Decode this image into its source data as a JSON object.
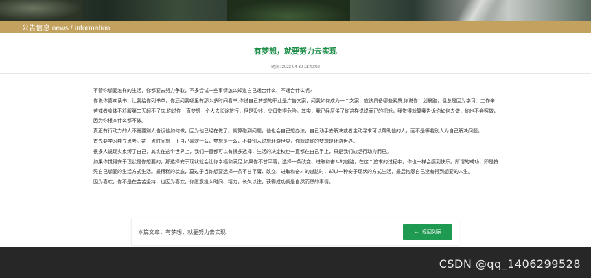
{
  "section": {
    "label": "公告信息 news / information"
  },
  "article": {
    "title": "有梦想，就要努力去实现",
    "time_label": "时间:",
    "time_value": "2023-04-30 11:40:02",
    "paragraphs": [
      "不管你想要怎样的生活，你都要去努力争取，不多尝试一些事情怎么知道自己适合什么、不适合什么呢?",
      "你说你喜欢读书，让我给你列书单，你还问我哪里有那么多时间看书,你说自己梦想的职业是广告文案，问我如何成为一个文案，应该具备哪些素质,你说你计划晨跑，但总是因为学习、工作辛苦或者身体不舒服第二天起不了床,你说你一直梦想一个人去长途旅行，但是没钱，父母觉得危险。其实，我已经厌倦了你这样说说而已的把戏，我觉得就算我告诉你如何去做，你也不会照做，因为你根本什么都不做。",
      "真正有行动力的人不需要别人告诉他如何做，因为他已经在做了。就算碰到问题，他也会自己想办法，自己动手去解决或者主动寻求可以帮助他的人，而不是等着别人为自己解决问题。",
      "首先要学习独立思考。花一点时间想一下自己喜欢什么，梦想是什么，不要别人说想环游世界，你就说你的梦想是环游世界。",
      "很多人说现实束缚了自己，其实在这个世界上，我们一直都可以有很多选择，生活的决定权也一直都在自己手上，只是我们缺乏行动力而已。",
      "如果你觉得安于现状是你想要的，那选择安于现状就会让你幸福和满足;如果你不甘平庸，选择一条改变、进取和奋斗的道路，在这个追求的过程中，你也一样会感到快乐。所谓的成功，即是按照自己想要的生活方式生活。最糟糕的状态，莫过于当你想要选择一条不甘平庸、改变、进取和奋斗的道路时，却以一种安于现状的方式生活，最后抱怨自己没有得到想要的人生。",
      "因为喜欢，你不是在苦苦坚持，也因为喜欢，你愿意投入时间、精力，长久以往，获得成功就是自然而然的事情。"
    ]
  },
  "footer_nav": {
    "current_article": "本篇文章：有梦想，就要努力去实现",
    "back_button_label": "返回列表",
    "back_icon": "arrow-left-icon"
  },
  "watermark": {
    "text": "CSDN @qq_1406299528"
  },
  "colors": {
    "accent_green": "#1f8f4a",
    "section_gold": "#c3a15e",
    "footer_dark": "#272727"
  }
}
